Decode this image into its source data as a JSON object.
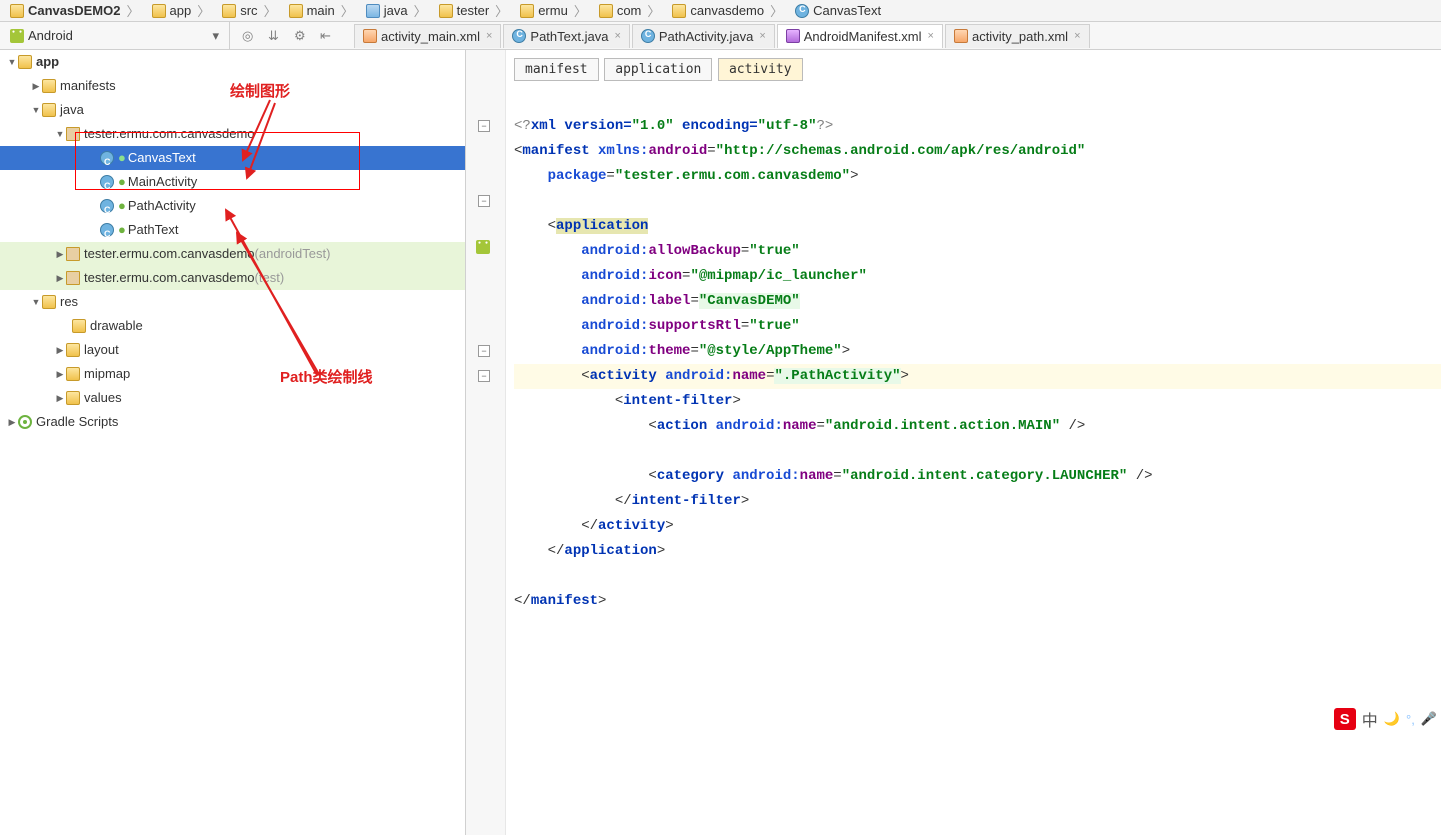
{
  "breadcrumbs": [
    "CanvasDEMO2",
    "app",
    "src",
    "main",
    "java",
    "tester",
    "ermu",
    "com",
    "canvasdemo",
    "CanvasText"
  ],
  "variant": "Android",
  "tabs": [
    {
      "label": "activity_main.xml",
      "type": "xml",
      "active": false
    },
    {
      "label": "PathText.java",
      "type": "class",
      "active": false
    },
    {
      "label": "PathActivity.java",
      "type": "class",
      "active": false
    },
    {
      "label": "AndroidManifest.xml",
      "type": "manifest",
      "active": true
    },
    {
      "label": "activity_path.xml",
      "type": "xml",
      "active": false
    }
  ],
  "tree": {
    "app": "app",
    "manifests": "manifests",
    "java": "java",
    "pkg1": "tester.ermu.com.canvasdemo",
    "cls1": "CanvasText",
    "cls2": "MainActivity",
    "cls3": "PathActivity",
    "cls4": "PathText",
    "pkg2": "tester.ermu.com.canvasdemo",
    "pkg2suffix": "(androidTest)",
    "pkg3": "tester.ermu.com.canvasdemo",
    "pkg3suffix": "(test)",
    "res": "res",
    "drawable": "drawable",
    "layout": "layout",
    "mipmap": "mipmap",
    "values": "values",
    "gradle": "Gradle Scripts"
  },
  "anno1": "绘制图形",
  "anno2": "Path类绘制线",
  "crumbs": [
    "manifest",
    "application",
    "activity"
  ],
  "code": {
    "l1a": "<?",
    "l1b": "xml version=",
    "l1c": "\"1.0\"",
    "l1d": " encoding=",
    "l1e": "\"utf-8\"",
    "l1f": "?>",
    "l2a": "<",
    "l2b": "manifest ",
    "l2c": "xmlns:",
    "l2d": "android",
    "l2e": "=",
    "l2f": "\"http://schemas.android.com/apk/res/android\"",
    "l3a": "package",
    "l3b": "=",
    "l3c": "\"tester.ermu.com.canvasdemo\"",
    "l3d": ">",
    "l4a": "<",
    "l4b": "application",
    "l5a": "android:",
    "l5b": "allowBackup",
    "l5c": "=",
    "l5d": "\"true\"",
    "l6a": "android:",
    "l6b": "icon",
    "l6c": "=",
    "l6d": "\"@mipmap/ic_launcher\"",
    "l7a": "android:",
    "l7b": "label",
    "l7c": "=",
    "l7d": "\"CanvasDEMO\"",
    "l8a": "android:",
    "l8b": "supportsRtl",
    "l8c": "=",
    "l8d": "\"true\"",
    "l9a": "android:",
    "l9b": "theme",
    "l9c": "=",
    "l9d": "\"@style/AppTheme\"",
    "l9e": ">",
    "l10a": "<",
    "l10b": "activity ",
    "l10c": "android:",
    "l10d": "name",
    "l10e": "=",
    "l10f": "\".PathActivity\"",
    "l10g": ">",
    "l11a": "<",
    "l11b": "intent-filter",
    "l11c": ">",
    "l12a": "<",
    "l12b": "action ",
    "l12c": "android:",
    "l12d": "name",
    "l12e": "=",
    "l12f": "\"android.intent.action.MAIN\"",
    "l12g": " />",
    "l13a": "<",
    "l13b": "category ",
    "l13c": "android:",
    "l13d": "name",
    "l13e": "=",
    "l13f": "\"android.intent.category.LAUNCHER\"",
    "l13g": " />",
    "l14": "</",
    "l14b": "intent-filter",
    "l14c": ">",
    "l15": "</",
    "l15b": "activity",
    "l15c": ">",
    "l16": "</",
    "l16b": "application",
    "l16c": ">",
    "l17": "</",
    "l17b": "manifest",
    "l17c": ">"
  },
  "ime": {
    "logo": "S",
    "text": "中"
  }
}
